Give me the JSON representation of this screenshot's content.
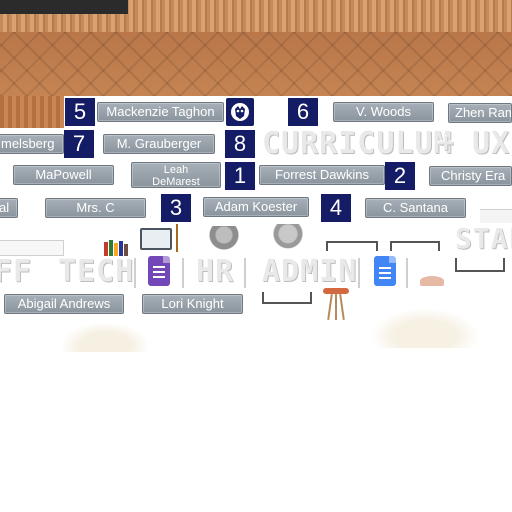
{
  "plates": {
    "mackenzie": "Mackenzie Taghon",
    "vwoods": "V. Woods",
    "zhen": "Zhen Ram",
    "melsberg": "melsberg",
    "grauberger": "M. Grauberger",
    "mapowell": "MaPowell",
    "leah_line1": "Leah",
    "leah_line2": "DeMarest",
    "forrest": "Forrest Dawkins",
    "christy": "Christy Era",
    "left_edge": "al",
    "mrsc": "Mrs. C",
    "adam": "Adam Koester",
    "santana": "C. Santana",
    "abigail": "Abigail Andrews",
    "lori": "Lori Knight"
  },
  "numbers": {
    "n5": "5",
    "n6": "6",
    "n7": "7",
    "n8": "8",
    "n1": "1",
    "n2": "2",
    "n3": "3",
    "n4": "4"
  },
  "headings": {
    "curriculum": "CURRICULUM",
    "plus": "+",
    "ux": "UX",
    "staff_right": "STAF",
    "staff_left": "FF",
    "tech": "TECH",
    "hr": "HR",
    "admin": "ADMIN"
  },
  "icons": {
    "forms": "google-forms-icon",
    "docs": "google-docs-icon",
    "mascot": "mascot-logo-icon"
  },
  "colors": {
    "number_badge": "#141c66",
    "plate": "#969fa8",
    "forms_purple": "#7248b9",
    "docs_blue": "#4285f4"
  }
}
